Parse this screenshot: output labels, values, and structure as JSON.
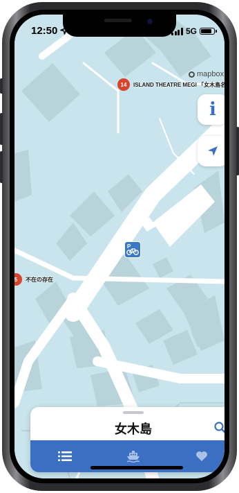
{
  "status_bar": {
    "time": "12:50",
    "network": "5G",
    "signal_bars": 4,
    "battery_level": 0.85
  },
  "map": {
    "attribution": "mapbox",
    "pois": [
      {
        "number": "14",
        "label": "ISLAND THEATRE MEGI 「女木島名画座」"
      },
      {
        "number": "5",
        "label": "不在の存在"
      }
    ],
    "parking_icon": "bicycle-parking-icon",
    "colors": {
      "water": "#c9e4ec",
      "road": "#ffffff",
      "building": "#b9d3db",
      "poi": "#d9432c"
    }
  },
  "controls": {
    "info_label": "i",
    "info_icon": "info-icon",
    "location_icon": "location-arrow-icon"
  },
  "sheet": {
    "title": "女木島",
    "search_icon": "search-icon"
  },
  "tabs": [
    {
      "name": "list",
      "icon": "list-icon",
      "active": true
    },
    {
      "name": "ferry",
      "icon": "ferry-icon",
      "active": false
    },
    {
      "name": "favorites",
      "icon": "heart-icon",
      "active": false
    }
  ],
  "accent_color": "#3a6fc4"
}
